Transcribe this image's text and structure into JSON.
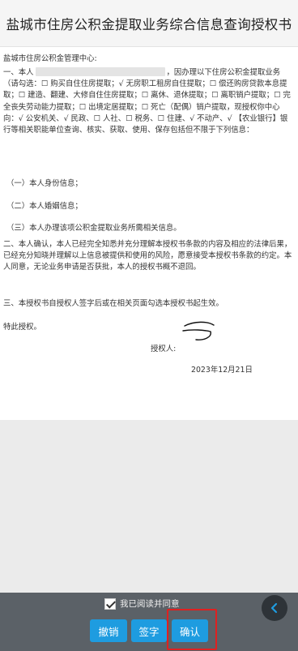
{
  "title": "盐城市住房公积金提取业务综合信息查询授权书",
  "document": {
    "addressee": "盐城市住房公积金管理中心:",
    "para1_before_name": "一、本人",
    "para1_after_name": "，因办理以下住房公积金提取业务（请勾选：☐ 购买自住住房提取；√ 无房职工租房自住提取；☐ 偿还购房贷款本息提取；☐ 建造、翻建、大修自住住房提取；☐ 离休、退休提取；☐ 离职销户提取；☐ 完全丧失劳动能力提取；☐ 出境定居提取；☐ 死亡（配偶）销户提取，现授权你中心向：√ 公安机关、√ 民政、☐ 人社、☐ 税务、☐ 住建、√ 不动产、√ 【农业银行】银行等相关职能单位查询、核实、获取、使用、保存包括但不限于下列信息：",
    "items": [
      "（一）本人身份信息；",
      "（二）本人婚姻信息；",
      "（三）本人办理该项公积金提取业务所需相关信息。"
    ],
    "para2": "二、本人确认，本人已经完全知悉并充分理解本授权书条款的内容及相应的法律后果，已经充分知晓并理解以上信息被提供和使用的风险，愿意接受本授权书条款的约定。本人同意，无论业务申请是否获批，本人的授权书概不退回。",
    "para3": "三、本授权书自授权人签字后或在相关页面勾选本授权书起生效。",
    "special": "特此授权。",
    "sign_label": "授权人:",
    "date": "2023年12月21日"
  },
  "footer": {
    "agree_label": "我已阅读并同意",
    "agree_checked": true,
    "buttons": {
      "cancel": "撤销",
      "sign": "签字",
      "confirm": "确认"
    },
    "back_icon": "chevron-left-icon"
  },
  "colors": {
    "button_bg": "#1e9ce0",
    "footer_bg": "#5b6167",
    "highlight_border": "#e02020",
    "back_icon_color": "#1e9ce0"
  }
}
